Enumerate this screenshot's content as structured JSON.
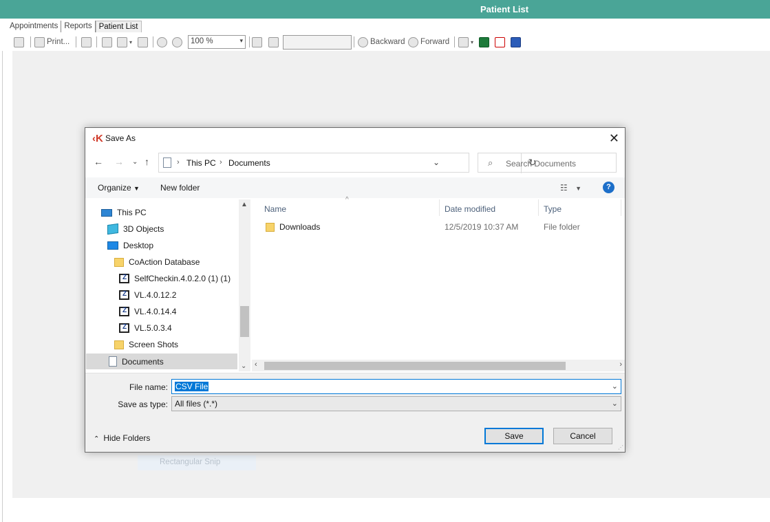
{
  "window": {
    "title": "Patient List"
  },
  "tabs": [
    {
      "label": "Appointments"
    },
    {
      "label": "Reports"
    },
    {
      "label": "Patient List"
    }
  ],
  "toolbar": {
    "print_label": "Print...",
    "zoom_value": "100 %",
    "backward_label": "Backward",
    "forward_label": "Forward"
  },
  "background_snip_text": "Rectangular Snip",
  "dialog": {
    "title": "Save As",
    "breadcrumb": [
      "This PC",
      "Documents"
    ],
    "search_placeholder": "Search Documents",
    "organize_label": "Organize",
    "new_folder_label": "New folder",
    "help_glyph": "?",
    "nav_tree": [
      {
        "label": "This PC",
        "icon": "computer-icon"
      },
      {
        "label": "3D Objects",
        "icon": "cube-icon"
      },
      {
        "label": "Desktop",
        "icon": "desktop-icon"
      },
      {
        "label": "CoAction Database",
        "icon": "folder-icon"
      },
      {
        "label": "SelfCheckin.4.0.2.0 (1) (1)",
        "icon": "zip-icon"
      },
      {
        "label": "VL.4.0.12.2",
        "icon": "zip-icon"
      },
      {
        "label": "VL.4.0.14.4",
        "icon": "zip-icon"
      },
      {
        "label": "VL.5.0.3.4",
        "icon": "zip-icon"
      },
      {
        "label": "Screen Shots",
        "icon": "folder-icon"
      },
      {
        "label": "Documents",
        "icon": "document-icon",
        "selected": true
      }
    ],
    "columns": {
      "name": "Name",
      "date": "Date modified",
      "type": "Type"
    },
    "files": [
      {
        "name": "Downloads",
        "date": "12/5/2019 10:37 AM",
        "type": "File folder"
      }
    ],
    "file_name_label": "File name:",
    "file_name_value": "CSV File",
    "save_type_label": "Save as type:",
    "save_type_value": "All files (*.*)",
    "hide_folders_label": "Hide Folders",
    "save_label": "Save",
    "cancel_label": "Cancel"
  }
}
